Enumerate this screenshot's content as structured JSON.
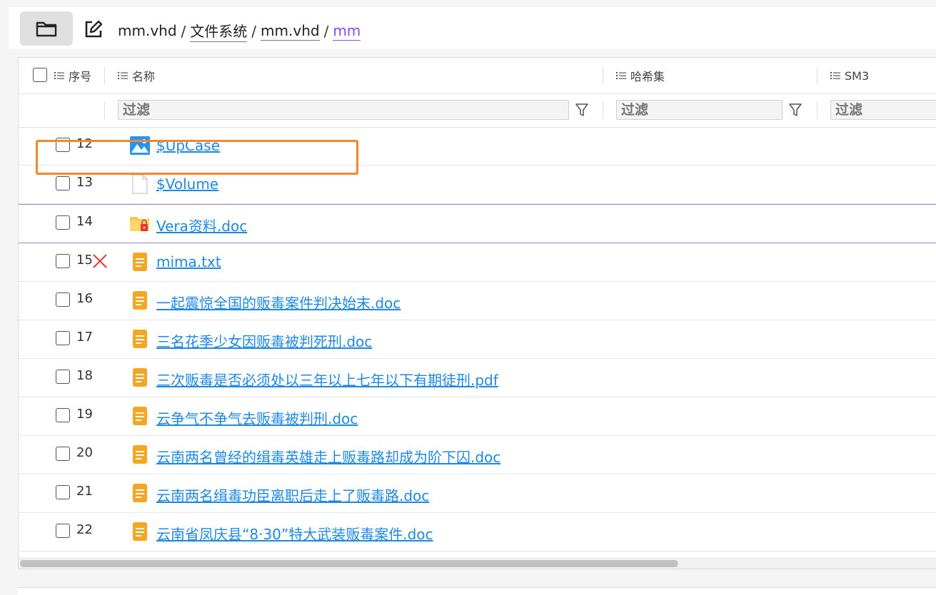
{
  "breadcrumb": [
    "mm.vhd",
    "文件系统",
    "mm.vhd",
    "mm"
  ],
  "breadcrumb_separator": "/",
  "columns": {
    "index": "序号",
    "name": "名称",
    "hashset": "哈希集",
    "sm3": "SM3"
  },
  "filters": {
    "name_placeholder": "过滤",
    "hashset_placeholder": "过滤",
    "sm3_placeholder": "过滤"
  },
  "rows": [
    {
      "index": "12",
      "name": "$UpCase",
      "icon": "image-file-icon"
    },
    {
      "index": "13",
      "name": "$Volume",
      "icon": "blank-file-icon"
    },
    {
      "index": "14",
      "name": "Vera资料.doc",
      "icon": "locked-folder-icon"
    },
    {
      "index": "15",
      "name": "mima.txt",
      "icon": "document-file-icon",
      "deleted": true
    },
    {
      "index": "16",
      "name": "一起震惊全国的贩毒案件判决始末.doc",
      "icon": "document-file-icon"
    },
    {
      "index": "17",
      "name": "三名花季少女因贩毒被判死刑.doc",
      "icon": "document-file-icon"
    },
    {
      "index": "18",
      "name": "三次贩毒是否必须处以三年以上七年以下有期徒刑.pdf",
      "icon": "document-file-icon"
    },
    {
      "index": "19",
      "name": "云争气不争气去贩毒被判刑.doc",
      "icon": "document-file-icon"
    },
    {
      "index": "20",
      "name": "云南两名曾经的缉毒英雄走上贩毒路却成为阶下囚.doc",
      "icon": "document-file-icon"
    },
    {
      "index": "21",
      "name": "云南两名缉毒功臣离职后走上了贩毒路.doc",
      "icon": "document-file-icon"
    },
    {
      "index": "22",
      "name": "云南省凤庆县“8·30”特大武装贩毒案件.doc",
      "icon": "document-file-icon"
    }
  ],
  "colors": {
    "link": "#1e88e5",
    "breadcrumb_current": "#7c4dff",
    "highlight": "#f5862a",
    "deleted_mark": "#e53935",
    "doc_icon": "#f5a623"
  }
}
